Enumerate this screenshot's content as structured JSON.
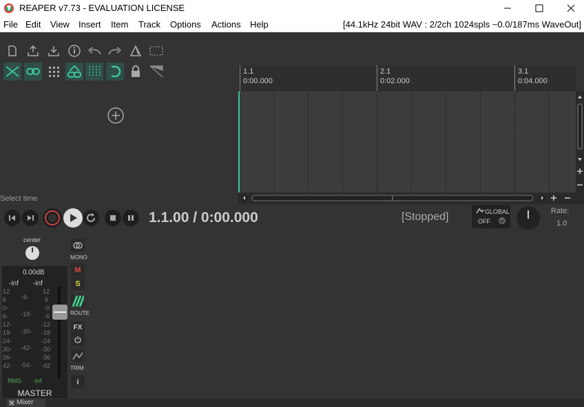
{
  "app": {
    "title": "REAPER v7.73 - EVALUATION LICENSE"
  },
  "menu": {
    "items": [
      "File",
      "Edit",
      "View",
      "Insert",
      "Item",
      "Track",
      "Options",
      "Actions",
      "Help"
    ],
    "status": "[44.1kHz 24bit WAV : 2/2ch 1024spls ~0.0/187ms WaveOut]"
  },
  "ruler": {
    "markers": [
      {
        "bar": "1.1",
        "time": "0:00.000"
      },
      {
        "bar": "2.1",
        "time": "0:02.000"
      },
      {
        "bar": "3.1",
        "time": "0:04.000"
      }
    ]
  },
  "tcp": {
    "select_time": "Select time"
  },
  "transport": {
    "position": "1.1.00 / 0:00.000",
    "status": "[Stopped]",
    "global_label": "GLOBAL",
    "global_value": "OFF",
    "rate_label": "Rate:",
    "rate_value": "1.0"
  },
  "master": {
    "pan_label": "center",
    "volume": "0.00dB",
    "peak_l": "-inf",
    "peak_r": "-inf",
    "rms_label": "RMS",
    "rms_value": "-inf",
    "name": "MASTER",
    "scale_left": [
      "12",
      "6",
      "0-",
      "6-",
      "12-",
      "18-",
      "24-",
      "30-",
      "36-",
      "42-"
    ],
    "scale_mid": [
      "-6-",
      "-18-",
      "-30-",
      "-42-",
      "-54-"
    ],
    "scale_right": [
      "12",
      "6",
      "-0",
      "-6",
      "-12",
      "-18",
      "-24",
      "-30",
      "-36",
      "-42"
    ],
    "mono_label": "MONO",
    "route_label": "ROUTE",
    "trim_label": "TRIM",
    "m_label": "M",
    "s_label": "S",
    "fx_label": "FX",
    "info_label": "i"
  },
  "bottom": {
    "mixer_tab": "Mixer"
  },
  "colors": {
    "accent": "#3ec4a0",
    "record": "#c44",
    "panel": "#333",
    "timeline": "#3c3c3c"
  }
}
